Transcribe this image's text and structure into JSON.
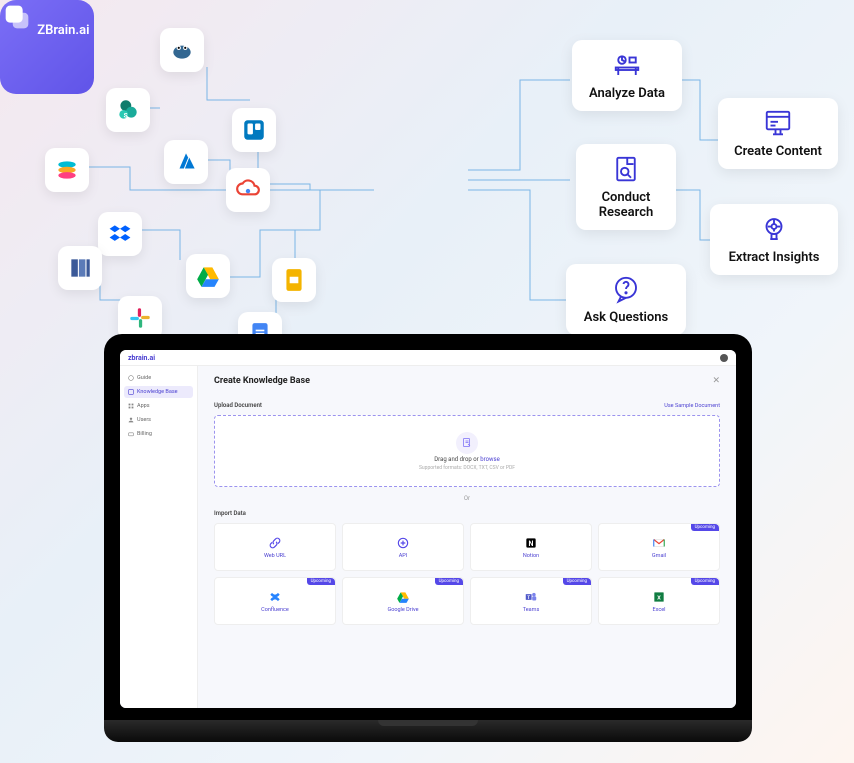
{
  "brand": {
    "center_label": "ZBrain.ai"
  },
  "features": [
    {
      "id": "analyze-data",
      "label": "Analyze Data"
    },
    {
      "id": "create-content",
      "label": "Create Content"
    },
    {
      "id": "conduct-research",
      "label": "Conduct\nResearch"
    },
    {
      "id": "extract-insights",
      "label": "Extract Insights"
    },
    {
      "id": "ask-questions",
      "label": "Ask Questions"
    }
  ],
  "source_icons": [
    "postgresql",
    "sharepoint",
    "trello",
    "azure",
    "elastic",
    "google-cloud",
    "dropbox",
    "google-drive",
    "google-slides",
    "aws",
    "slack",
    "google-docs"
  ],
  "app": {
    "logo": "zbrain.ai",
    "sidebar": [
      {
        "label": "Guide",
        "active": false
      },
      {
        "label": "Knowledge Base",
        "active": true
      },
      {
        "label": "Apps",
        "active": false
      },
      {
        "label": "Users",
        "active": false
      },
      {
        "label": "Billing",
        "active": false
      }
    ],
    "title": "Create Knowledge Base",
    "upload_label": "Upload Document",
    "sample_link_prefix": "Use ",
    "sample_link": "Sample Document",
    "dropzone": {
      "text_prefix": "Drag and drop or ",
      "browse": "browse",
      "subtext": "Supported formats: DOCX, TXT, CSV or PDF"
    },
    "or_label": "Or",
    "import_label": "Import Data",
    "upcoming_badge": "Upcoming",
    "import_sources": [
      {
        "label": "Web URL",
        "upcoming": false,
        "icon": "link"
      },
      {
        "label": "API",
        "upcoming": false,
        "icon": "api"
      },
      {
        "label": "Notion",
        "upcoming": false,
        "icon": "notion"
      },
      {
        "label": "Gmail",
        "upcoming": true,
        "icon": "gmail"
      },
      {
        "label": "Confluence",
        "upcoming": true,
        "icon": "confluence"
      },
      {
        "label": "Google Drive",
        "upcoming": true,
        "icon": "gdrive"
      },
      {
        "label": "Teams",
        "upcoming": true,
        "icon": "teams"
      },
      {
        "label": "Excel",
        "upcoming": true,
        "icon": "excel"
      }
    ]
  }
}
